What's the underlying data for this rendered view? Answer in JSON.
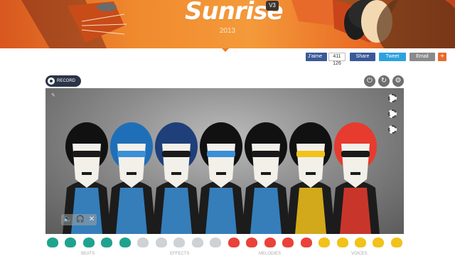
{
  "header": {
    "title": "Sunrise",
    "version": "V3",
    "year": "2013"
  },
  "social": {
    "fb_like": "J'aime",
    "fb_count": "411 126",
    "fb_share": "Share",
    "tweet": "Tweet",
    "email": "Email",
    "plus": "+"
  },
  "toolbar": {
    "record_label": "RECORD"
  },
  "icons": {
    "power": "power-icon",
    "reset": "reset-icon",
    "settings": "gear-icon",
    "mute": "mute-icon",
    "solo": "headphones-icon",
    "remove": "close-icon"
  },
  "characters": [
    {
      "name": "character-1",
      "accent": "#3a8fd6",
      "hair": "#111111"
    },
    {
      "name": "character-2",
      "accent": "#3a8fd6",
      "hair": "#1f6fb8"
    },
    {
      "name": "character-3",
      "accent": "#3a8fd6",
      "hair": "#1e3f7a"
    },
    {
      "name": "character-4",
      "accent": "#3a8fd6",
      "hair": "#111111"
    },
    {
      "name": "character-5",
      "accent": "#3a8fd6",
      "hair": "#111111"
    },
    {
      "name": "character-6",
      "accent": "#f2c21b",
      "hair": "#111111"
    },
    {
      "name": "character-7",
      "accent": "#e63b2e",
      "hair": "#e63b2e"
    }
  ],
  "palette": {
    "groups": [
      "BEATS",
      "EFFECTS",
      "MELODIES",
      "VOICES"
    ],
    "colors": [
      "#1fa38f",
      "#1fa38f",
      "#1fa38f",
      "#1fa38f",
      "#1fa38f",
      "#cfd2d4",
      "#cfd2d4",
      "#cfd2d4",
      "#cfd2d4",
      "#cfd2d4",
      "#e9423a",
      "#e9423a",
      "#e9423a",
      "#e9423a",
      "#e9423a",
      "#f2c21b",
      "#f2c21b",
      "#f2c21b",
      "#f2c21b",
      "#f2c21b"
    ]
  }
}
